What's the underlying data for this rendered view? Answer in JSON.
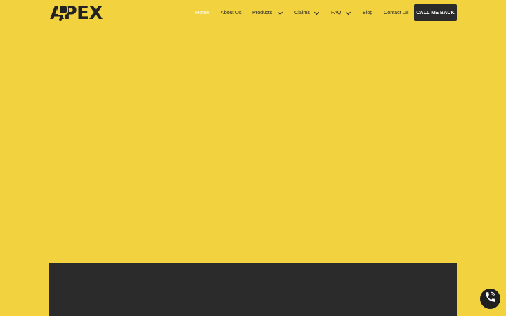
{
  "brand": {
    "logo_text_a": "A",
    "logo_text_rest": "PEX"
  },
  "nav": {
    "items": [
      {
        "label": "Home",
        "active": true,
        "has_dropdown": false
      },
      {
        "label": "About Us",
        "active": false,
        "has_dropdown": false
      },
      {
        "label": "Products",
        "active": false,
        "has_dropdown": true
      },
      {
        "label": "Claims",
        "active": false,
        "has_dropdown": true
      },
      {
        "label": "FAQ",
        "active": false,
        "has_dropdown": true
      },
      {
        "label": "Blog",
        "active": false,
        "has_dropdown": false
      },
      {
        "label": "Contact Us",
        "active": false,
        "has_dropdown": false
      }
    ],
    "cta_label": "CALL ME BACK"
  },
  "colors": {
    "background": "#f2d23e",
    "dark": "#2b2b2b",
    "active_text": "#ffffff",
    "text": "#222222"
  },
  "icons": {
    "chevron": "chevron-down-icon",
    "phone": "phone-icon"
  }
}
